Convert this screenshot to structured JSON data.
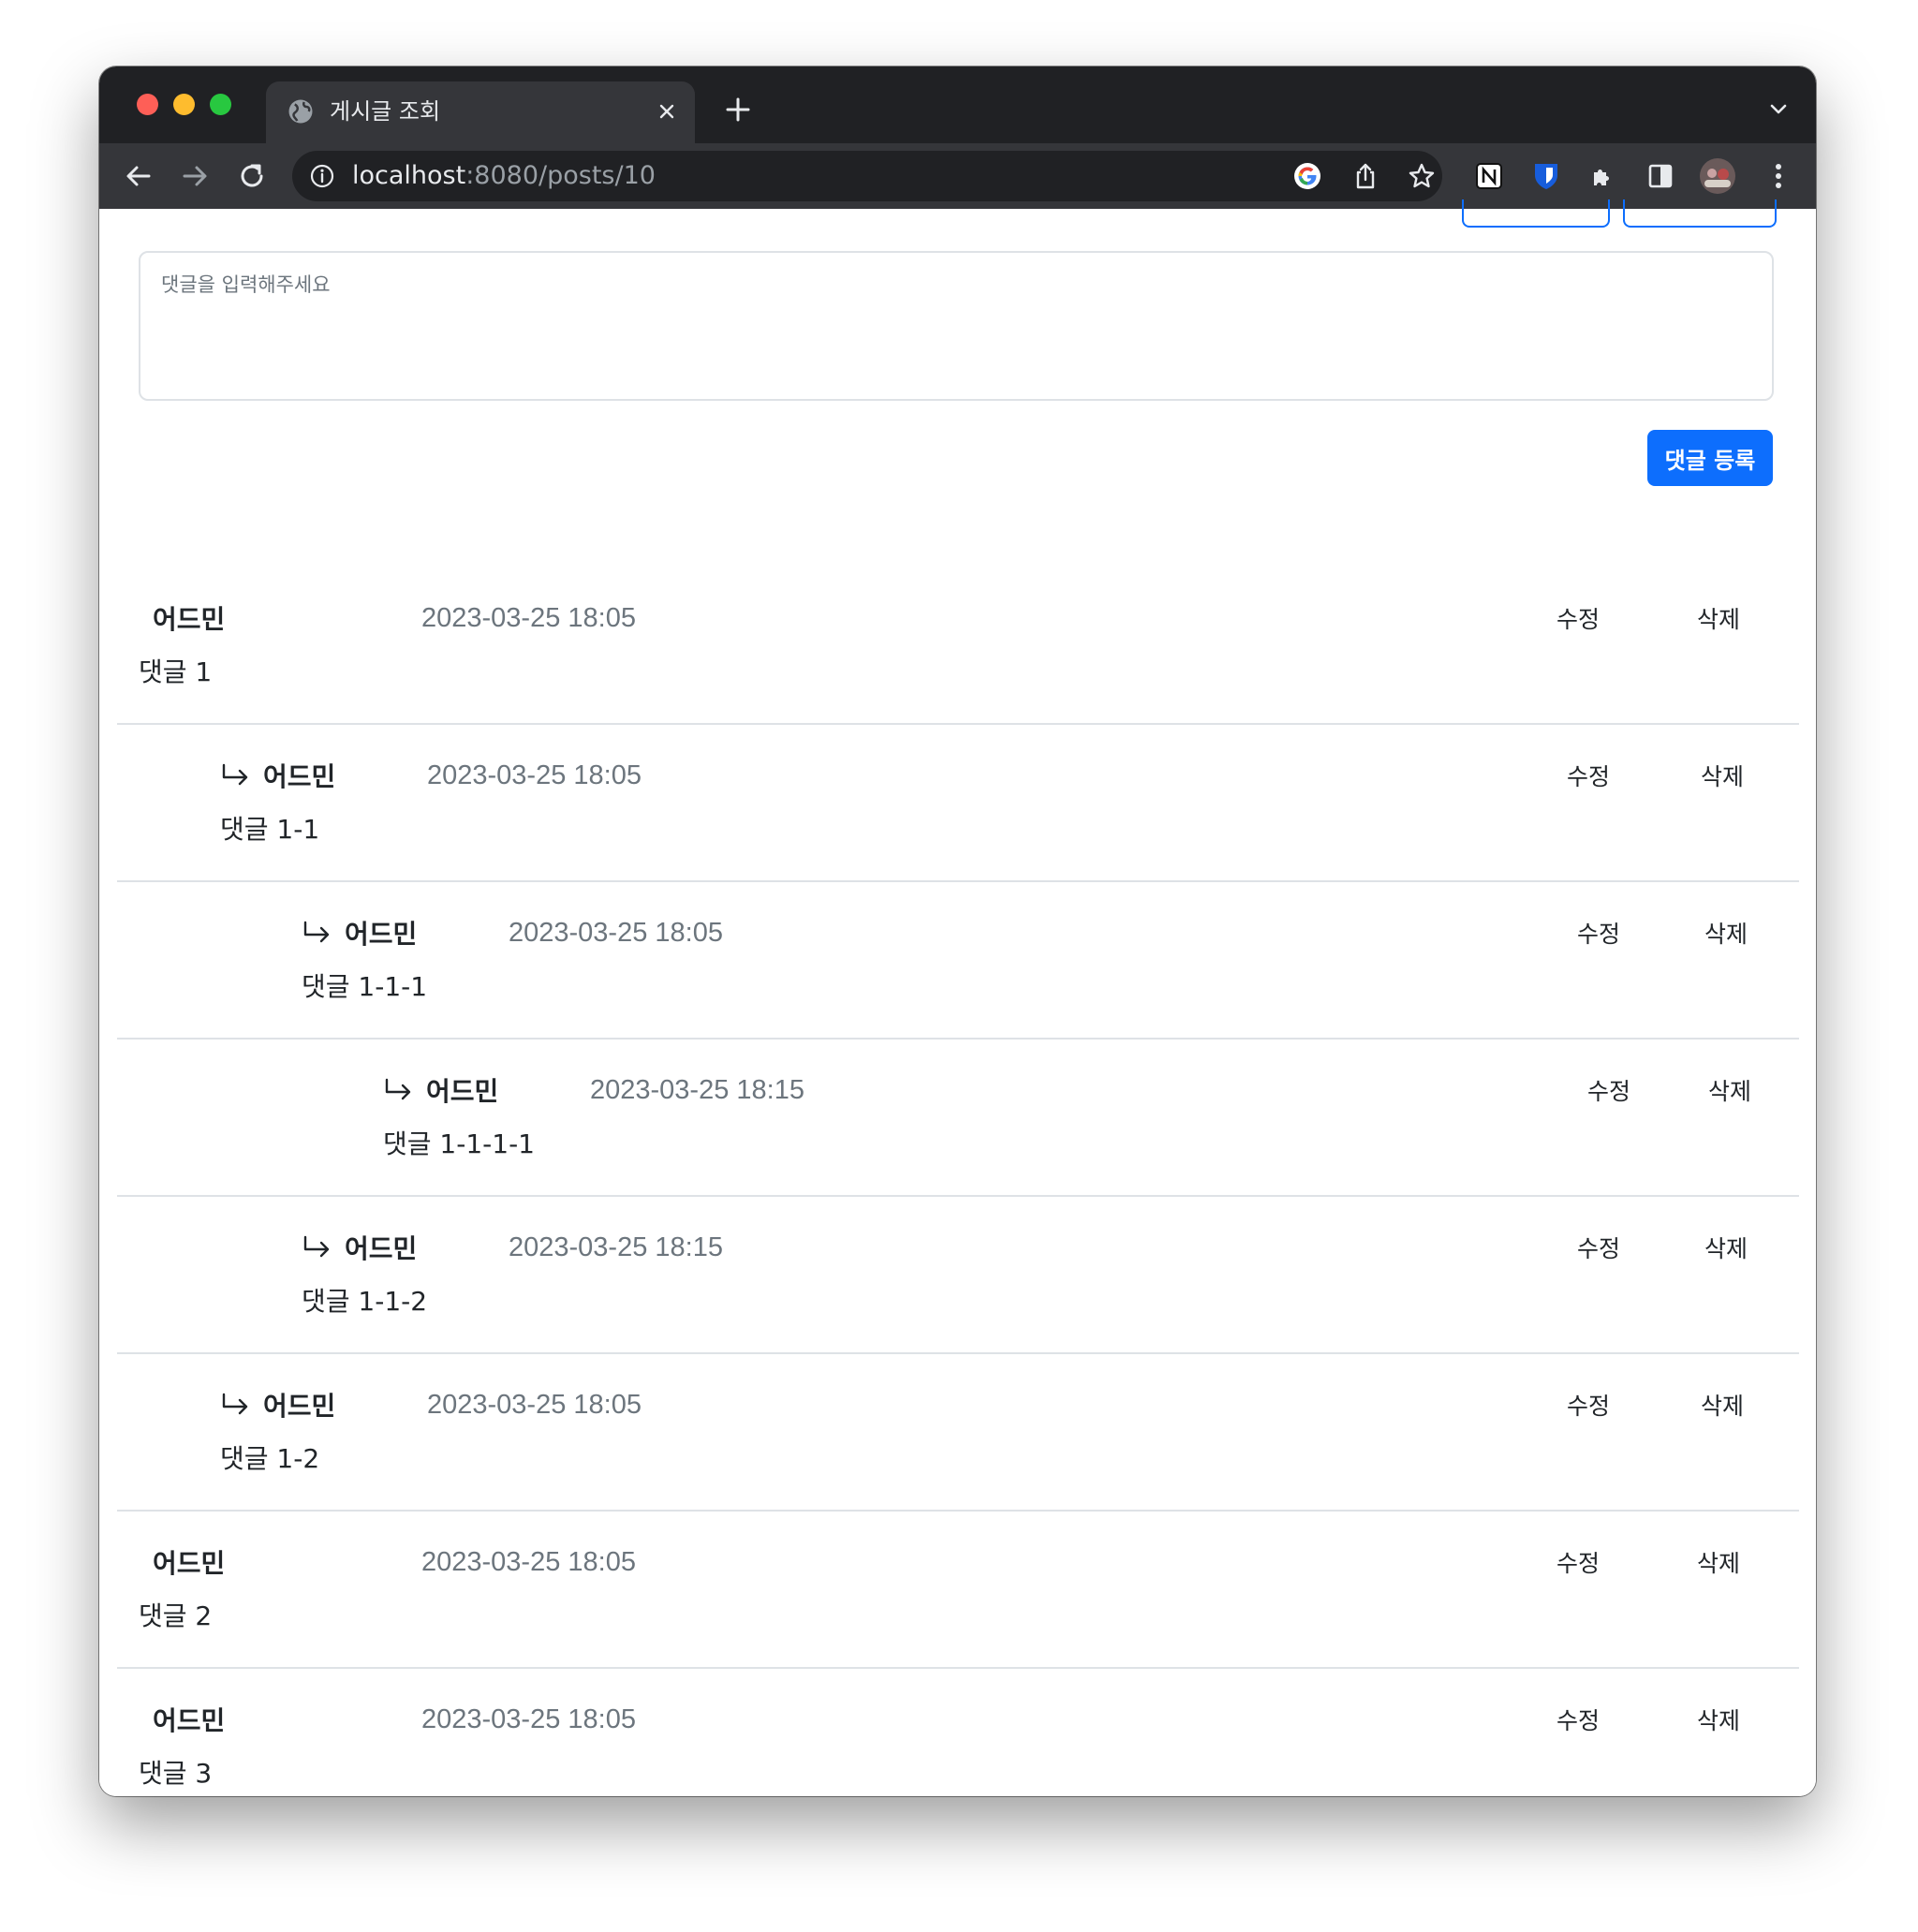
{
  "browser": {
    "tab_title": "게시글 조회",
    "url_host": "localhost",
    "url_path": ":8080/posts/10"
  },
  "comment_form": {
    "placeholder": "댓글을 입력해주세요",
    "submit_label": "댓글 등록"
  },
  "actions": {
    "edit": "수정",
    "delete": "삭제"
  },
  "comments": [
    {
      "depth": 0,
      "author": "어드민",
      "date": "2023-03-25 18:05",
      "body": "댓글 1"
    },
    {
      "depth": 1,
      "author": "어드민",
      "date": "2023-03-25 18:05",
      "body": "댓글 1-1"
    },
    {
      "depth": 2,
      "author": "어드민",
      "date": "2023-03-25 18:05",
      "body": "댓글 1-1-1"
    },
    {
      "depth": 3,
      "author": "어드민",
      "date": "2023-03-25 18:15",
      "body": "댓글 1-1-1-1"
    },
    {
      "depth": 2,
      "author": "어드민",
      "date": "2023-03-25 18:15",
      "body": "댓글 1-1-2"
    },
    {
      "depth": 1,
      "author": "어드민",
      "date": "2023-03-25 18:05",
      "body": "댓글 1-2"
    },
    {
      "depth": 0,
      "author": "어드민",
      "date": "2023-03-25 18:05",
      "body": "댓글 2"
    },
    {
      "depth": 0,
      "author": "어드민",
      "date": "2023-03-25 18:05",
      "body": "댓글 3"
    }
  ],
  "colors": {
    "primary": "#0d6efd",
    "chrome_dark": "#202124",
    "chrome_toolbar": "#35363a",
    "muted_text": "#6c757d",
    "divider": "#dee2e6"
  }
}
